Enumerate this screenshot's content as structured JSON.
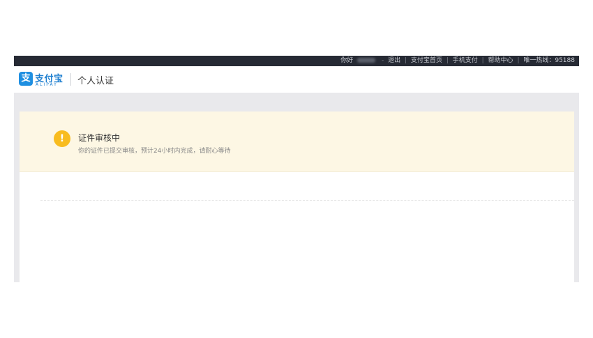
{
  "topbar": {
    "greeting": "你好",
    "logout": "退出",
    "links": [
      "支付宝首页",
      "手机支付",
      "帮助中心"
    ],
    "hotline": "唯一热线：95188"
  },
  "header": {
    "logo_text": "支付宝",
    "logo_sub": "ALIPAY",
    "page_title": "个人认证"
  },
  "notice": {
    "icon": "!",
    "title": "证件审核中",
    "description": "你的证件已提交审核，预计24小时内完成，请耐心等待"
  },
  "colors": {
    "topbar_bg": "#262a34",
    "brand_blue": "#1e8fe1",
    "notice_bg": "#fdf7e4",
    "warning_icon": "#f8bc1f"
  }
}
